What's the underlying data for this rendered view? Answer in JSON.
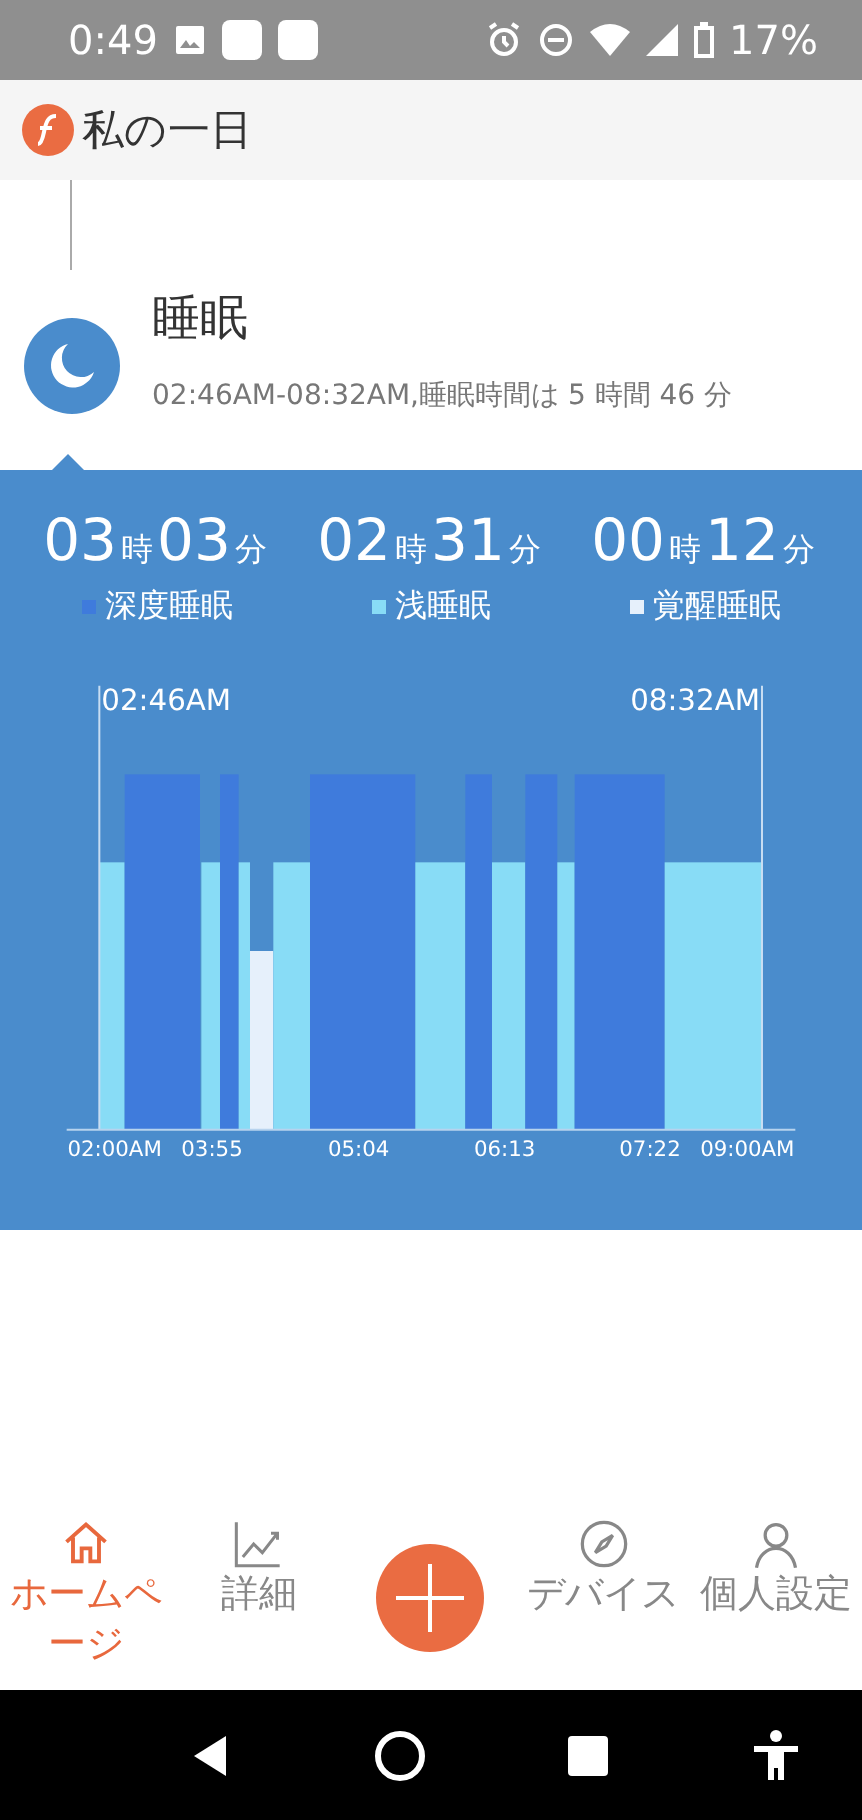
{
  "status_bar": {
    "time": "0:49",
    "battery": "17%"
  },
  "header": {
    "title": "私の一日"
  },
  "entry": {
    "title": "睡眠",
    "subtitle": "02:46AM-08:32AM,睡眠時間は 5 時間 46 分"
  },
  "summary": [
    {
      "hours": "03",
      "hour_unit": "時",
      "minutes": "03",
      "minute_unit": "分",
      "label": "深度睡眠",
      "color": "#3f7bdc"
    },
    {
      "hours": "02",
      "hour_unit": "時",
      "minutes": "31",
      "minute_unit": "分",
      "label": "浅睡眠",
      "color": "#88dcf6"
    },
    {
      "hours": "00",
      "hour_unit": "時",
      "minutes": "12",
      "minute_unit": "分",
      "label": "覚醒睡眠",
      "color": "#e6f0fb"
    }
  ],
  "chart": {
    "start_label": "02:46AM",
    "end_label": "08:32AM",
    "axis_labels": [
      "02:00AM",
      "03:55",
      "05:04",
      "06:13",
      "07:22",
      "09:00AM"
    ]
  },
  "nav": [
    {
      "label": "ホームページ",
      "selected": true
    },
    {
      "label": "詳細",
      "selected": false
    },
    {
      "kind": "add"
    },
    {
      "label": "デバイス",
      "selected": false
    },
    {
      "label": "個人設定",
      "selected": false
    }
  ]
}
